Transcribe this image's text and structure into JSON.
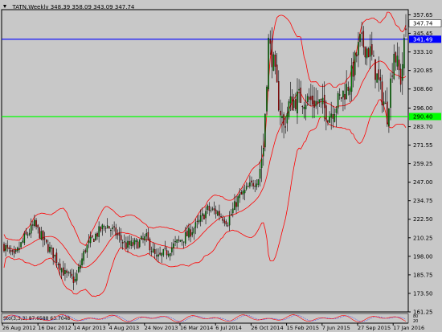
{
  "window": {
    "header": "_TATN,Weekly  348.39 358.09 343.09 347.74",
    "colors": {
      "background": "#c8c8c8",
      "bull_candle": "#008000",
      "bear_candle": "#b00000",
      "bands": "#ff0000",
      "blue_line": "#0000ff",
      "green_line": "#00ff00",
      "axis_text": "#000000"
    }
  },
  "chart_data": {
    "type": "candlestick",
    "symbol": "_TATN",
    "timeframe": "Weekly",
    "ohlc_last": {
      "open": 348.39,
      "high": 358.09,
      "low": 343.09,
      "close": 347.74
    },
    "ylim": [
      161.25,
      360.0
    ],
    "yticks": [
      357.65,
      345.45,
      333.1,
      320.85,
      308.6,
      296.0,
      283.7,
      271.55,
      259.25,
      247.0,
      234.75,
      222.5,
      210.25,
      198.0,
      185.75,
      173.5,
      161.25
    ],
    "ytick_labels": [
      "357.65",
      "345.45",
      "333.10",
      "320.85",
      "308.60",
      "296.00",
      "283.70",
      "271.55",
      "259.25",
      "247.00",
      "234.75",
      "222.50",
      "210.25",
      "198.00",
      "185.75",
      "173.50",
      "161.25"
    ],
    "xticks": [
      "26 Aug 2012",
      "16 Dec 2012",
      "14 Apr 2013",
      "4 Aug 2013",
      "24 Nov 2013",
      "16 Mar 2014",
      "6 Jul 2014",
      "26 Oct 2014",
      "15 Feb 2015",
      "7 Jun 2015",
      "27 Sep 2015",
      "17 Jan 2016"
    ],
    "close_profile": [
      {
        "w": 0,
        "c": 205
      },
      {
        "w": 6,
        "c": 197
      },
      {
        "w": 12,
        "c": 210
      },
      {
        "w": 18,
        "c": 219
      },
      {
        "w": 24,
        "c": 207
      },
      {
        "w": 30,
        "c": 198
      },
      {
        "w": 36,
        "c": 186
      },
      {
        "w": 42,
        "c": 182
      },
      {
        "w": 48,
        "c": 203
      },
      {
        "w": 54,
        "c": 212
      },
      {
        "w": 60,
        "c": 219
      },
      {
        "w": 66,
        "c": 213
      },
      {
        "w": 72,
        "c": 205
      },
      {
        "w": 78,
        "c": 206
      },
      {
        "w": 84,
        "c": 210
      },
      {
        "w": 90,
        "c": 196
      },
      {
        "w": 96,
        "c": 201
      },
      {
        "w": 102,
        "c": 207
      },
      {
        "w": 108,
        "c": 212
      },
      {
        "w": 114,
        "c": 219
      },
      {
        "w": 120,
        "c": 229
      },
      {
        "w": 126,
        "c": 227
      },
      {
        "w": 132,
        "c": 221
      },
      {
        "w": 138,
        "c": 236
      },
      {
        "w": 144,
        "c": 243
      },
      {
        "w": 150,
        "c": 250
      },
      {
        "w": 153,
        "c": 270
      },
      {
        "w": 156,
        "c": 340
      },
      {
        "w": 159,
        "c": 325
      },
      {
        "w": 162,
        "c": 300
      },
      {
        "w": 165,
        "c": 283
      },
      {
        "w": 168,
        "c": 298
      },
      {
        "w": 174,
        "c": 303
      },
      {
        "w": 180,
        "c": 301
      },
      {
        "w": 186,
        "c": 299
      },
      {
        "w": 192,
        "c": 292
      },
      {
        "w": 198,
        "c": 302
      },
      {
        "w": 204,
        "c": 313
      },
      {
        "w": 210,
        "c": 340
      },
      {
        "w": 216,
        "c": 333
      },
      {
        "w": 222,
        "c": 308
      },
      {
        "w": 226,
        "c": 292
      },
      {
        "w": 230,
        "c": 334
      },
      {
        "w": 234,
        "c": 315
      },
      {
        "w": 237,
        "c": 348
      }
    ],
    "total_weeks": 238,
    "horizontal_lines": [
      {
        "name": "blue-level",
        "value": 341.49,
        "label": "341.49",
        "color": "#0000ff"
      },
      {
        "name": "green-level",
        "value": 290.4,
        "label": "290.40",
        "color": "#00ff00"
      }
    ],
    "current_price_label": "347.74",
    "indicator": {
      "label": "Sto(3,3,3) 87.6588 63.7048",
      "levels": [
        "80",
        "20"
      ],
      "main_color": "#ff0000",
      "signal_color": "#0000ff"
    }
  }
}
